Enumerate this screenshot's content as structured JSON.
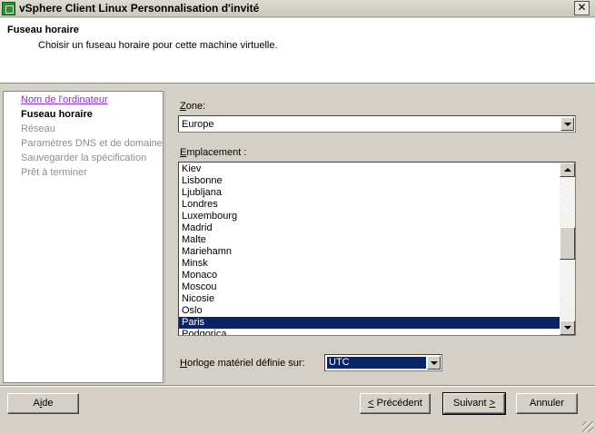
{
  "window": {
    "title": "vSphere Client Linux Personnalisation d'invité",
    "close_glyph": "✕"
  },
  "header": {
    "title": "Fuseau horaire",
    "subtitle": "Choisir un fuseau horaire pour cette machine virtuelle."
  },
  "nav": {
    "items": [
      {
        "label": "Nom de l'ordinateur",
        "state": "visited"
      },
      {
        "label": "Fuseau horaire",
        "state": "current"
      },
      {
        "label": "Réseau",
        "state": "disabled"
      },
      {
        "label": "Paramètres DNS et de domaine",
        "state": "disabled"
      },
      {
        "label": "Sauvegarder la spécification",
        "state": "disabled"
      },
      {
        "label": "Prêt à terminer",
        "state": "disabled"
      }
    ]
  },
  "zone": {
    "label_mnemonic": "Z",
    "label_rest": "one:",
    "value": "Europe"
  },
  "location": {
    "label_mnemonic": "E",
    "label_rest": "mplacement :",
    "items": [
      "Kiev",
      "Lisbonne",
      "Ljubljana",
      "Londres",
      "Luxembourg",
      "Madrid",
      "Malte",
      "Mariehamn",
      "Minsk",
      "Monaco",
      "Moscou",
      "Nicosie",
      "Oslo",
      "Paris",
      "Podgorica"
    ],
    "selected": "Paris",
    "scroll_position": 0.45
  },
  "clock": {
    "label_mnemonic": "H",
    "label_rest": "orloge matériel définie sur:",
    "value": "UTC"
  },
  "footer": {
    "help": {
      "pre": "A",
      "mnemonic": "i",
      "post": "de"
    },
    "back": {
      "pre": "",
      "mnemonic": "<",
      "post": " Précédent"
    },
    "next": {
      "pre": "Suivant ",
      "mnemonic": ">",
      "post": ""
    },
    "cancel": "Annuler"
  },
  "colors": {
    "selection": "#0a246a",
    "visited_link": "#8a2be2",
    "dialog_bg": "#d4d0c8"
  }
}
